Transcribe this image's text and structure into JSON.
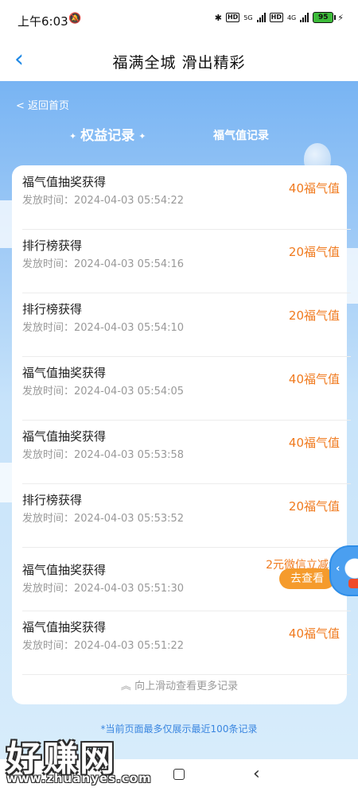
{
  "status": {
    "time": "上午6:03",
    "network_5g": "5G",
    "network_4g": "4G",
    "hd1": "HD",
    "hd2": "HD",
    "battery": "95"
  },
  "nav": {
    "title": "福满全城 滑出精彩"
  },
  "header": {
    "back_home": "< 返回首页",
    "tab_active": "权益记录",
    "tab_inactive": "福气值记录"
  },
  "records": [
    {
      "name": "福气值抽奖获得",
      "time": "发放时间：2024-04-03 05:54:22",
      "amount": "40福气值"
    },
    {
      "name": "排行榜获得",
      "time": "发放时间：2024-04-03 05:54:16",
      "amount": "20福气值"
    },
    {
      "name": "排行榜获得",
      "time": "发放时间：2024-04-03 05:54:10",
      "amount": "20福气值"
    },
    {
      "name": "福气值抽奖获得",
      "time": "发放时间：2024-04-03 05:54:05",
      "amount": "40福气值"
    },
    {
      "name": "福气值抽奖获得",
      "time": "发放时间：2024-04-03 05:53:58",
      "amount": "40福气值"
    },
    {
      "name": "排行榜获得",
      "time": "发放时间：2024-04-03 05:53:52",
      "amount": "20福气值"
    },
    {
      "name": "福气值抽奖获得",
      "time": "发放时间：2024-04-03 05:51:30",
      "coupon": "2元微信立减金",
      "button": "去查看"
    },
    {
      "name": "福气值抽奖获得",
      "time": "发放时间：2024-04-03 05:51:22",
      "amount": "40福气值"
    }
  ],
  "more_hint": "向上滑动查看更多记录",
  "footnote": "*当前页面最多仅展示最近100条记录",
  "watermark": {
    "brand": "好赚网",
    "url": "www.zhuanyes.com"
  }
}
